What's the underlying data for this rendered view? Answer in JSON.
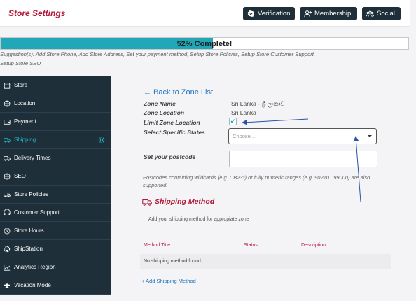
{
  "header": {
    "title": "Store Settings",
    "buttons": {
      "verification": "Verification",
      "membership": "Membership",
      "social": "Social"
    }
  },
  "progress": {
    "percent": 52,
    "label": "52% Complete!",
    "suggestion": "Suggestion(s): Add Store Phone, Add Store Address, Set your payment method, Setup Store Policies, Setup Store Customer Support, Setup Store SEO"
  },
  "sidebar": {
    "items": [
      {
        "label": "Store",
        "icon": "store-icon"
      },
      {
        "label": "Location",
        "icon": "globe-icon"
      },
      {
        "label": "Payment",
        "icon": "wallet-icon"
      },
      {
        "label": "Shipping",
        "icon": "truck-icon",
        "active": true
      },
      {
        "label": "Delivery Times",
        "icon": "truck-icon"
      },
      {
        "label": "SEO",
        "icon": "globe-icon"
      },
      {
        "label": "Store Policies",
        "icon": "truck-icon"
      },
      {
        "label": "Customer Support",
        "icon": "support-icon"
      },
      {
        "label": "Store Hours",
        "icon": "clock-icon"
      },
      {
        "label": "ShipStation",
        "icon": "gear-icon"
      },
      {
        "label": "Analytics Region",
        "icon": "chart-icon"
      },
      {
        "label": "Vacation Mode",
        "icon": "group-icon"
      }
    ]
  },
  "zone": {
    "back_link": "← Back to Zone List",
    "name_label": "Zone Name",
    "name_value": "Sri Lanka - ශ්‍රී ලංකාව",
    "location_label": "Zone Location",
    "location_value": "Sri Lanka",
    "limit_label": "Limit Zone Location",
    "limit_checked": true,
    "states_label": "Select Specific States",
    "states_placeholder": "Choose ...",
    "postcode_label": "Set your postcode",
    "postcode_value": "",
    "postcode_hint": "Postcodes containing wildcards (e.g. CB23*) or fully numeric ranges (e.g. 90210...99000) are also supported."
  },
  "shipping_method": {
    "title": "Shipping Method",
    "description": "Add your shipping method for appropiate zone",
    "columns": [
      "Method Title",
      "Status",
      "Description"
    ],
    "empty_text": "No shipping method found",
    "add_link": "+ Add Shipping Method"
  },
  "colors": {
    "accent": "#b3193a",
    "sidebar_bg": "#1e2f3a",
    "progress_fill": "#20a8b9",
    "link": "#1e73be"
  }
}
